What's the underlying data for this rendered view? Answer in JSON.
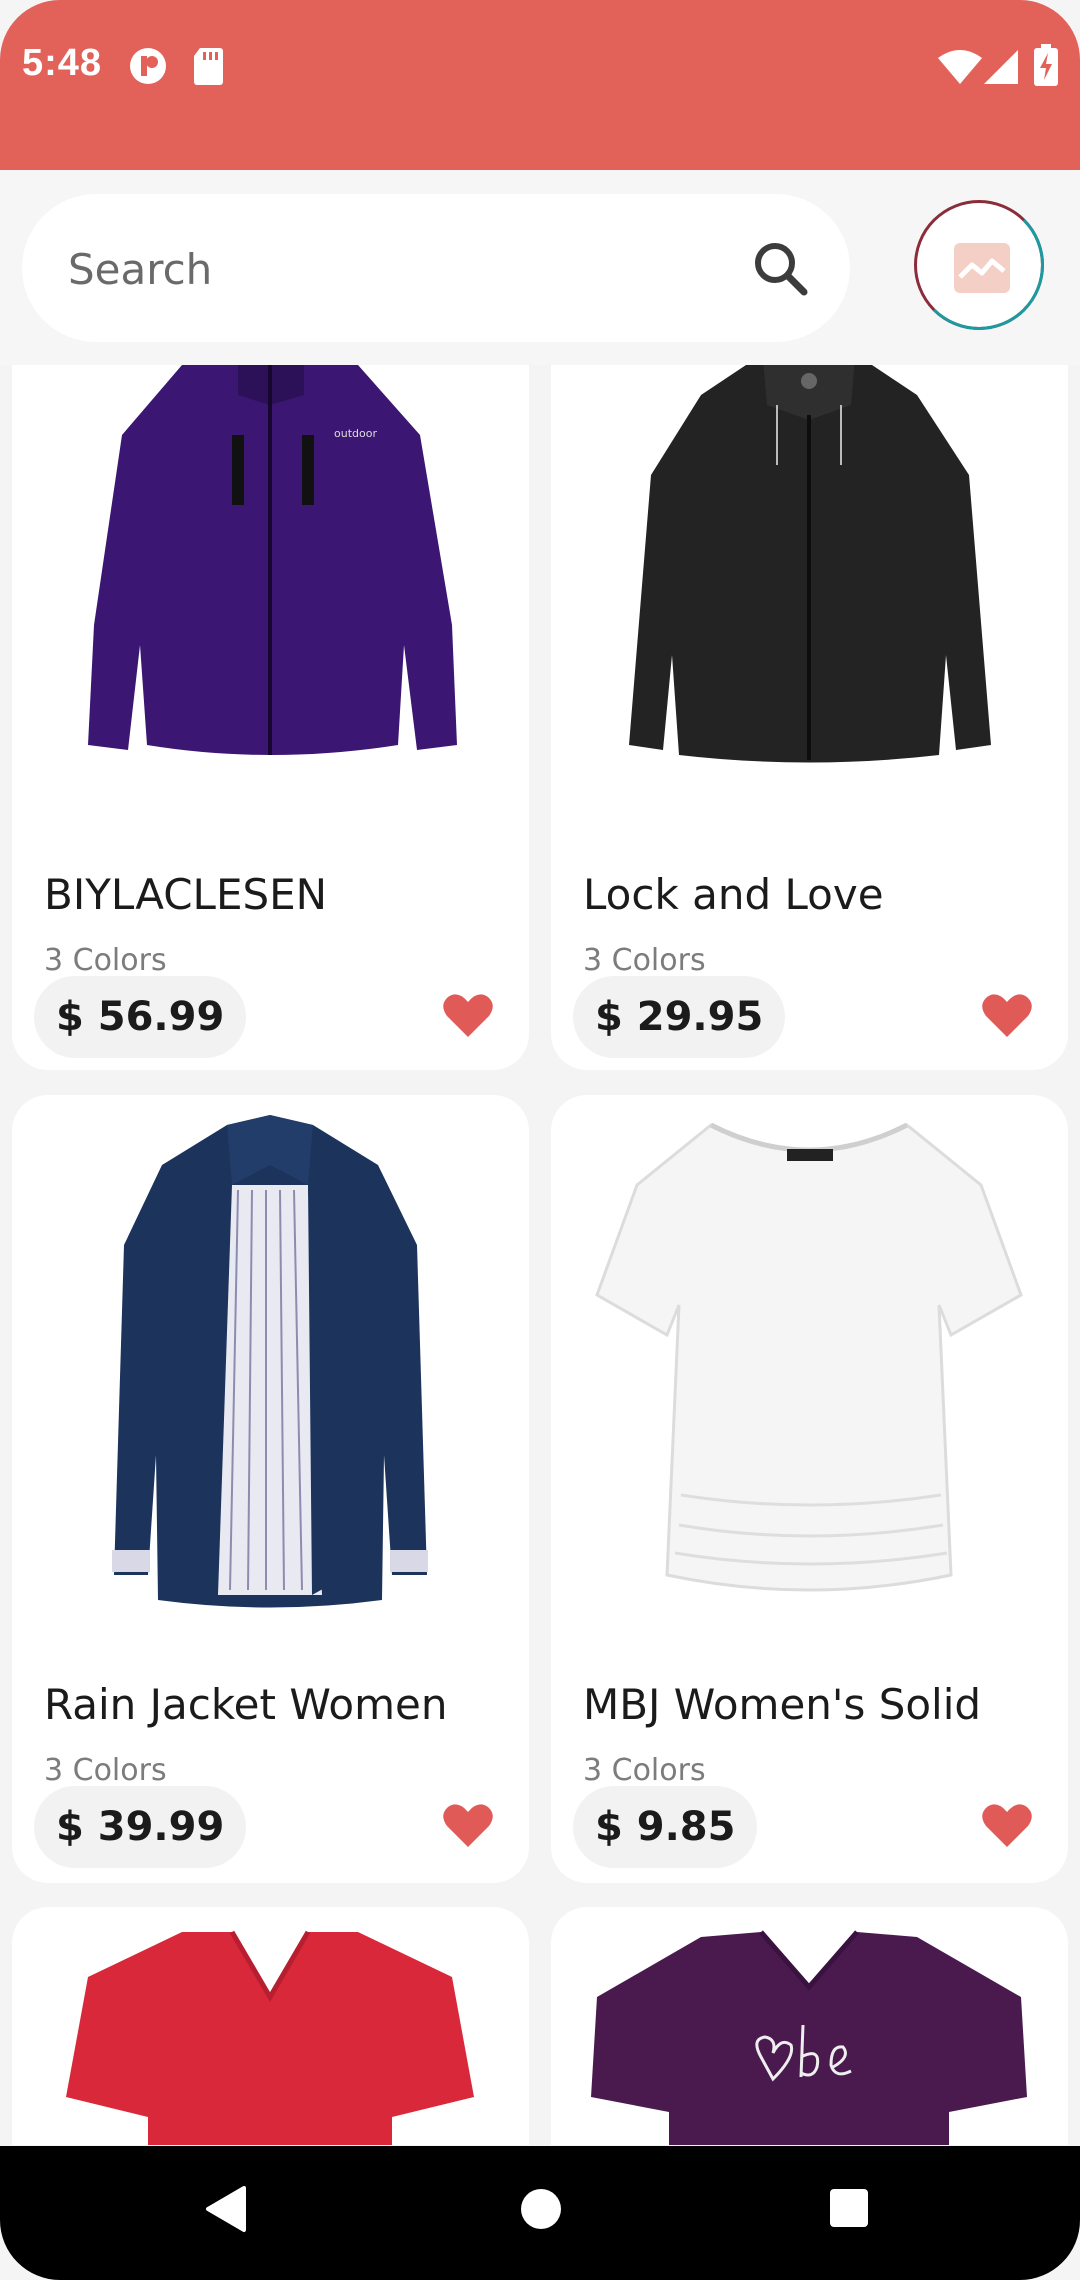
{
  "status_bar": {
    "time": "5:48",
    "bg_color": "#e2625a"
  },
  "search": {
    "placeholder": "Search",
    "value": ""
  },
  "products": [
    {
      "name": "BIYLACLESEN",
      "colors": "3 Colors",
      "price": "$ 56.99",
      "image": "purple-jacket",
      "favorited": true
    },
    {
      "name": "Lock and Love",
      "colors": "3 Colors",
      "price": "$ 29.95",
      "image": "black-leather-jacket",
      "favorited": true
    },
    {
      "name": "Rain Jacket Women",
      "colors": "3 Colors",
      "price": "$ 39.99",
      "image": "navy-rain-jacket",
      "favorited": true
    },
    {
      "name": "MBJ Women's Solid",
      "colors": "3 Colors",
      "price": "$ 9.85",
      "image": "white-tshirt",
      "favorited": true
    },
    {
      "name": "",
      "colors": "",
      "price": "",
      "image": "red-vneck-tshirt",
      "favorited": false
    },
    {
      "name": "",
      "colors": "",
      "price": "",
      "image": "purple-be-kind-tshirt",
      "favorited": false
    }
  ],
  "colors": {
    "accent": "#e2625a",
    "heart": "#e05a58",
    "background": "#f4f4f4"
  },
  "nav": {
    "back": "back-icon",
    "home": "home-icon",
    "recents": "recents-icon"
  }
}
